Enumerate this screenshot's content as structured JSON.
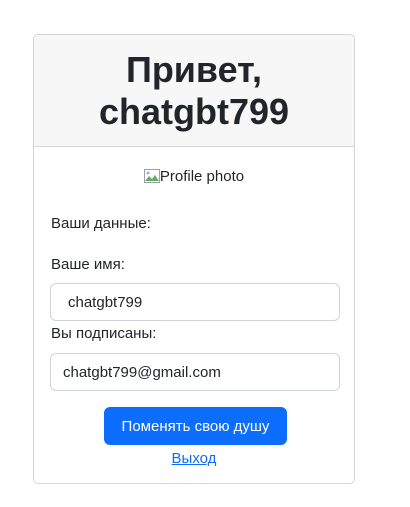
{
  "header": {
    "title": "Привет, chatgbt799"
  },
  "profile": {
    "photo_alt": "Profile photo"
  },
  "info": {
    "section_label": "Ваши данные:",
    "name_label": "Ваше имя:",
    "name_value": "chatgbt799",
    "subscribed_label": "Вы подписаны:",
    "email_value": "chatgbt799@gmail.com"
  },
  "actions": {
    "change_button": "Поменять свою душу",
    "logout_link": "Выход"
  },
  "colors": {
    "primary": "#0d6efd",
    "header_bg": "#f7f7f7",
    "border": "#d3d6da"
  }
}
